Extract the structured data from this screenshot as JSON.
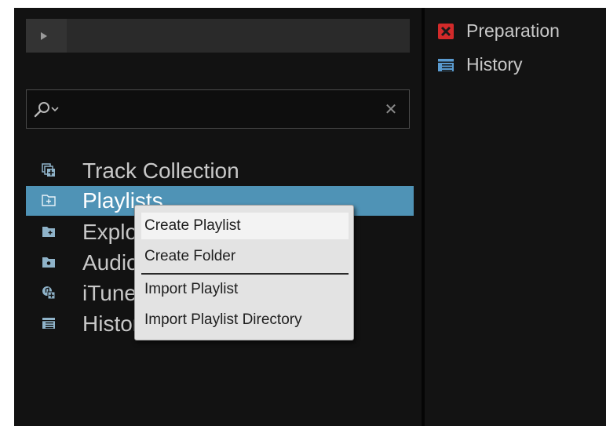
{
  "colors": {
    "selection": "#4f93b6",
    "panel_background": "#121212",
    "text": "#c8c8c8",
    "menu_background": "#e3e3e3",
    "preparation_icon": "#d22a2a",
    "history_icon": "#5a9bd0"
  },
  "preview_player": {
    "play_icon": "play-icon"
  },
  "search": {
    "value": "",
    "placeholder": "",
    "search_icon": "search-icon",
    "clear_icon": "close-icon",
    "clear_glyph": "✕"
  },
  "browser_tree": {
    "items": [
      {
        "label": "Track Collection",
        "icon": "track-collection-icon",
        "selected": false
      },
      {
        "label": "Playlists",
        "icon": "playlists-folder-icon",
        "selected": true
      },
      {
        "label": "Explorer",
        "icon": "explorer-folder-icon",
        "selected": false
      },
      {
        "label": "Audio Recordings",
        "icon": "audio-recordings-folder-icon",
        "selected": false
      },
      {
        "label": "iTunes",
        "icon": "itunes-icon",
        "selected": false
      },
      {
        "label": "History",
        "icon": "history-icon",
        "selected": false
      }
    ]
  },
  "context_menu": {
    "items": [
      {
        "label": "Create Playlist",
        "highlighted": true
      },
      {
        "label": "Create Folder",
        "highlighted": false
      },
      {
        "label": "Import Playlist",
        "highlighted": false
      },
      {
        "label": "Import Playlist Directory",
        "highlighted": false
      }
    ]
  },
  "favorites_panel": {
    "items": [
      {
        "label": "Preparation",
        "icon": "preparation-icon"
      },
      {
        "label": "History",
        "icon": "history-list-icon"
      }
    ]
  }
}
